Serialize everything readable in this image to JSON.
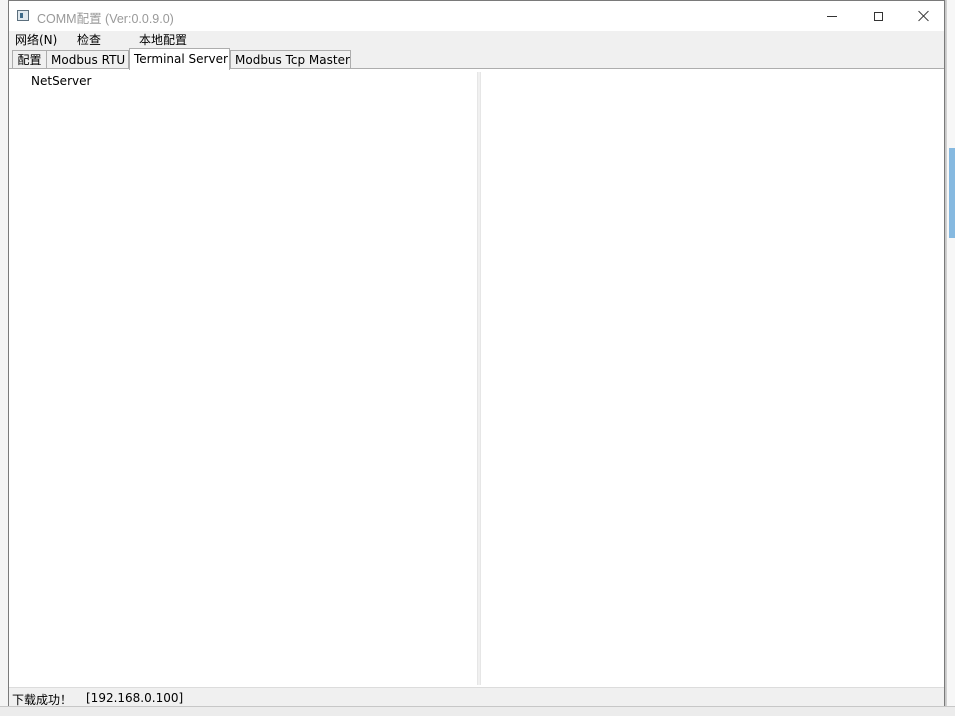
{
  "window": {
    "title": "COMM配置 (Ver:0.0.9.0)"
  },
  "menu": {
    "items": [
      {
        "label": "网络(N)"
      },
      {
        "label": "检查"
      },
      {
        "label": "本地配置"
      }
    ]
  },
  "tabs": [
    {
      "label": "配置"
    },
    {
      "label": "Modbus RTU"
    },
    {
      "label": "Terminal Server",
      "active": true
    },
    {
      "label": "Modbus Tcp Master"
    }
  ],
  "tree": {
    "items": [
      {
        "label": "NetServer"
      }
    ]
  },
  "status": {
    "message": "下载成功！",
    "ip": "[192.168.0.100]"
  },
  "colors": {
    "chrome": "#f0f0f0",
    "tab_border": "#adadad",
    "title_text": "#999999"
  }
}
